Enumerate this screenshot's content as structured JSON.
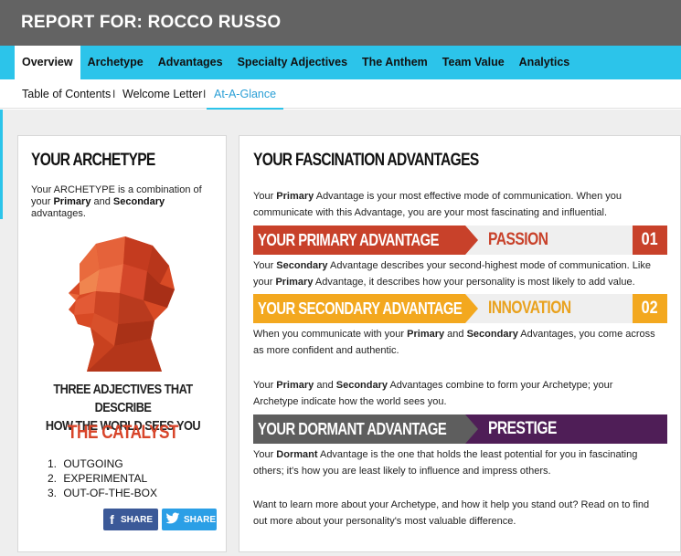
{
  "header": {
    "title": "REPORT FOR: ROCCO RUSSO"
  },
  "main_nav": {
    "items": [
      "Overview",
      "Archetype",
      "Advantages",
      "Specialty Adjectives",
      "The Anthem",
      "Team Value",
      "Analytics"
    ],
    "active": "Overview"
  },
  "sub_nav": {
    "items": [
      "Table of Contents",
      "Welcome Letter",
      "At-A-Glance"
    ],
    "separator": "I",
    "active": "At-A-Glance"
  },
  "archetype_card": {
    "title": "YOUR ARCHETYPE",
    "desc_1": "Your ARCHETYPE is a combination of your ",
    "desc_primary": "Primary",
    "desc_2": " and ",
    "desc_secondary": "Secondary",
    "desc_3": " advantages.",
    "adjectives_title_line1": "THREE ADJECTIVES THAT DESCRIBE",
    "adjectives_title_line2": "HOW THE WORLD SEES YOU",
    "archetype_name": "THE CATALYST",
    "adjectives": [
      {
        "n": "1.",
        "text": "OUTGOING"
      },
      {
        "n": "2.",
        "text": "EXPERIMENTAL"
      },
      {
        "n": "3.",
        "text": "OUT-OF-THE-BOX"
      }
    ],
    "share_facebook": "SHARE",
    "share_twitter": "SHARE",
    "facebook_icon": "f",
    "twitter_icon": "t"
  },
  "advantages_card": {
    "title": "YOUR FASCINATION ADVANTAGES",
    "para1_a": "Your ",
    "para1_b": "Primary",
    "para1_c": " Advantage is your most effective mode of communication. When you communicate with this Advantage, you are your most fascinating and influential.",
    "primary": {
      "label": "YOUR PRIMARY ADVANTAGE",
      "value": "PASSION",
      "number": "01",
      "color": "#c8412a",
      "value_color": "#c8412a"
    },
    "para2_a": "Your ",
    "para2_b": "Secondary",
    "para2_c": " Advantage describes your second-highest mode of communication. Like your ",
    "para2_d": "Primary",
    "para2_e": " Advantage, it describes how your personality is most likely to add value.",
    "secondary": {
      "label": "YOUR SECONDARY ADVANTAGE",
      "value": "INNOVATION",
      "number": "02",
      "color": "#f3a81f",
      "value_color": "#e9a21e"
    },
    "para3_a": "When you communicate with your ",
    "para3_b": "Primary",
    "para3_c": " and ",
    "para3_d": "Secondary",
    "para3_e": " Advantages, you come across as more confident and authentic.",
    "para4_a": "Your ",
    "para4_b": "Primary",
    "para4_c": " and ",
    "para4_d": "Secondary",
    "para4_e": " Advantages combine to form your Archetype; your Archetype indicate how the world sees you.",
    "dormant": {
      "label": "YOUR DORMANT ADVANTAGE",
      "value": "PRESTIGE",
      "color": "#5e5e5e",
      "value_bg": "#4f1e57"
    },
    "para5_a": "Your ",
    "para5_b": "Dormant",
    "para5_c": " Advantage is the one that holds the least potential for you in fascinating others; it's how you are least likely to influence and impress others.",
    "para6": "Want to learn more about your Archetype, and how it help you stand out? Read on to find out more about your personality's most valuable difference."
  }
}
